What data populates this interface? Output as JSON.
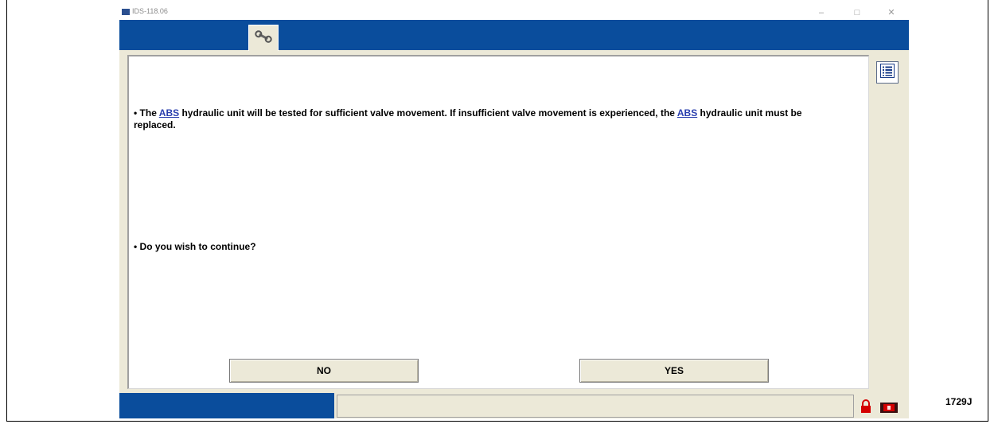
{
  "window": {
    "title": "IDS-118.06",
    "controls": {
      "minimize": "–",
      "maximize": "□",
      "close": "✕"
    }
  },
  "toolbar": {
    "active_tool_icon": "wrench-icon"
  },
  "content": {
    "paragraph1": {
      "bullet": "•",
      "part1": "The ",
      "abbr1": "ABS",
      "part2": " hydraulic unit will be tested for sufficient valve movement. If insufficient valve movement is experienced, the ",
      "abbr2": "ABS",
      "part3": " hydraulic unit must be replaced."
    },
    "paragraph2": {
      "bullet": "•",
      "text": "Do you wish to continue?"
    }
  },
  "buttons": {
    "no_label": "NO",
    "yes_label": "YES"
  },
  "side": {
    "list_icon": "list-icon"
  },
  "status": {
    "lock_icon": "padlock-icon",
    "device_icon": "vcm-device-icon"
  },
  "figure_ref": "1729J",
  "colors": {
    "toolbar_blue": "#0a4d9c",
    "window_bg": "#ece9d8",
    "link_blue": "#2a3fae",
    "alert_red": "#d40000"
  }
}
